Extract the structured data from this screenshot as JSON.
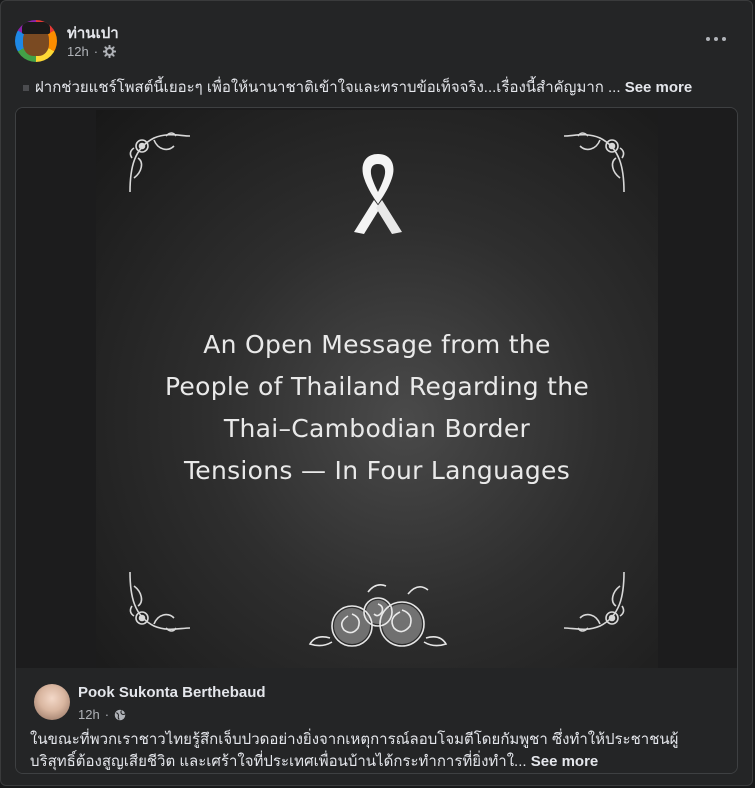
{
  "post": {
    "author": "ท่านเปา",
    "time": "12h",
    "privacy_icon": "gear-icon",
    "more_icon": "more-horizontal-icon",
    "text": "ฝากช่วยแชร์โพสต์นี้เยอะๆ เพื่อให้นานาชาติเข้าใจและทราบข้อเท็จจริง...เรื่องนี้สำคัญมาก ...",
    "see_more": "See more"
  },
  "shared_post": {
    "image": {
      "ribbon_icon": "awareness-ribbon-icon",
      "title_lines": [
        "An Open Message from the",
        "People of Thailand Regarding the",
        "Thai–Cambodian Border",
        "Tensions — In Four Languages"
      ]
    },
    "author": "Pook Sukonta Berthebaud",
    "time": "12h",
    "privacy_icon": "globe-icon",
    "text_line1": "ในขณะที่พวกเราชาวไทยรู้สึกเจ็บปวดอย่างยิ่งจากเหตุการณ์ลอบโจมตีโดยกัมพูชา ซึ่งทำให้ประชาชนผู้",
    "text_line2": "บริสุทธิ์ต้องสูญเสียชีวิต และเศร้าใจที่ประเทศเพื่อนบ้านได้กระทำการที่ยิ่งทำใ...",
    "see_more": "See more"
  },
  "colors": {
    "background": "#18191a",
    "card": "#242526",
    "text_primary": "#e4e6eb",
    "text_secondary": "#b0b3b8"
  }
}
